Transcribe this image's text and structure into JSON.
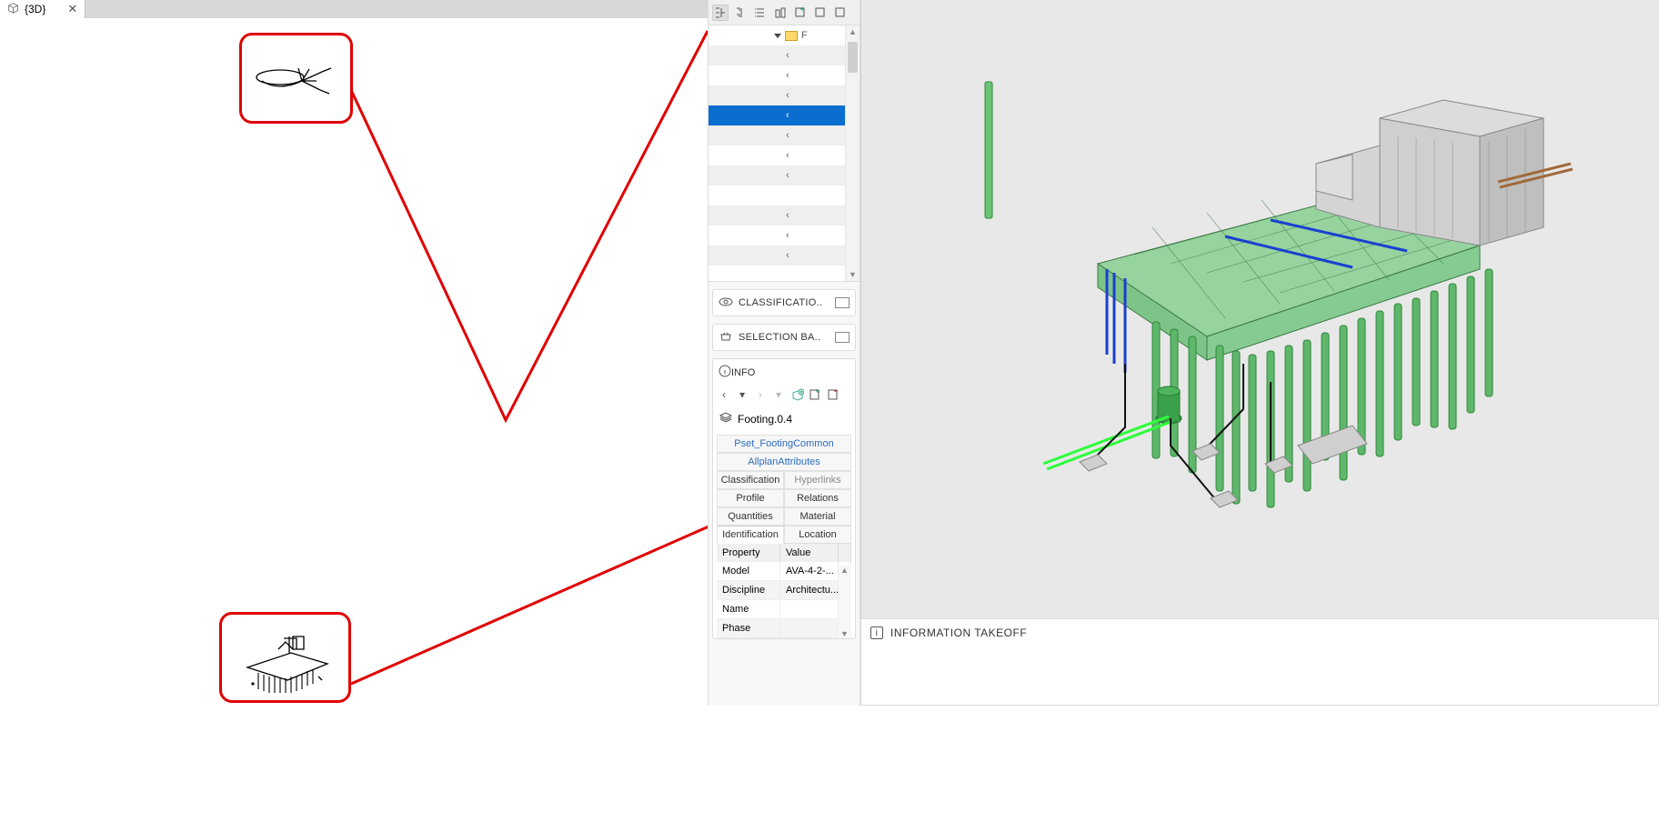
{
  "tab": {
    "label": "{3D}"
  },
  "tree": {
    "header_prefix": "F",
    "row_glyph": "‹",
    "rows": 11,
    "selected_index": 4
  },
  "panels": {
    "classification": "CLASSIFICATIO..",
    "selection_basket": "SELECTION BA..",
    "info": "INFO"
  },
  "info": {
    "object_name": "Footing.0.4",
    "tabs": {
      "pset_footing": "Pset_FootingCommon",
      "allplan": "AllplanAttributes",
      "classification": "Classification",
      "hyperlinks": "Hyperlinks",
      "profile": "Profile",
      "relations": "Relations",
      "quantities": "Quantities",
      "material": "Material",
      "identification": "Identification",
      "location": "Location"
    },
    "columns": {
      "property": "Property",
      "value": "Value"
    },
    "props": [
      {
        "k": "Model",
        "v": "AVA-4-2-..."
      },
      {
        "k": "Discipline",
        "v": "Architectu..."
      },
      {
        "k": "Name",
        "v": ""
      },
      {
        "k": "Phase",
        "v": ""
      }
    ]
  },
  "takeoff": {
    "title": "INFORMATION TAKEOFF"
  },
  "colors": {
    "annotation": "#e00000",
    "selection": "#0a6ed1",
    "model_green": "#8ed09a",
    "model_green_dark": "#4faf5a",
    "model_grey": "#bdbdbd",
    "model_blue": "#1a3fd1"
  }
}
